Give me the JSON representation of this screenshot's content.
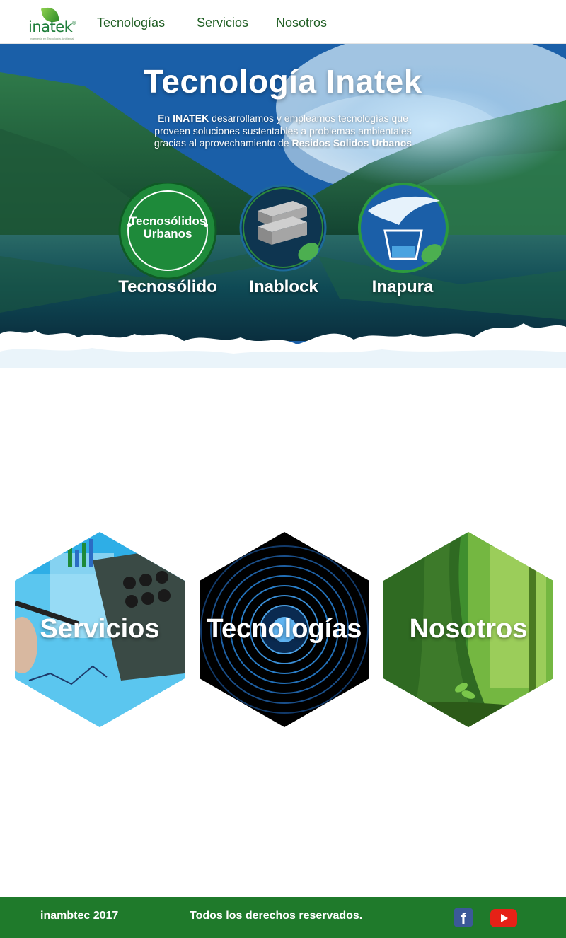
{
  "brand": {
    "logo_text": "inatek",
    "logo_reg": "®",
    "tagline": "Ingeniería en Tecnología Ambiental"
  },
  "nav": {
    "items": [
      "Tecnologías",
      "Servicios",
      "Nosotros"
    ]
  },
  "hero": {
    "title": "Tecnología Inatek",
    "text_prefix": "En ",
    "text_brand": "INATEK",
    "text_body": " desarrollamos y empleamos tecnologías que proveen soluciones sustentables a problemas ambientales gracias al aprovechamiento de ",
    "text_emphasis": "Residos Solidos Urbanos",
    "techs": [
      {
        "label": "Tecnosólido",
        "badge_line1": "Tecnosólidos",
        "badge_line2": "Urbanos",
        "icon": "tecnosolidos-badge-icon"
      },
      {
        "label": "Inablock",
        "icon": "inablock-bricks-icon"
      },
      {
        "label": "Inapura",
        "icon": "inapura-water-icon"
      }
    ]
  },
  "sections": [
    {
      "label": "Servicios",
      "icon": "calculator-chart-image"
    },
    {
      "label": "Tecnologías",
      "icon": "sound-rings-image"
    },
    {
      "label": "Nosotros",
      "icon": "forest-tree-image"
    }
  ],
  "footer": {
    "copyright": "inambtec 2017",
    "rights": "Todos los derechos reservados.",
    "social": [
      {
        "name": "facebook-icon",
        "glyph": "f"
      },
      {
        "name": "youtube-icon"
      }
    ]
  },
  "colors": {
    "brand_green": "#1f7a2b",
    "nav_text": "#1f5e23",
    "hero_blue": "#1a62b0"
  }
}
